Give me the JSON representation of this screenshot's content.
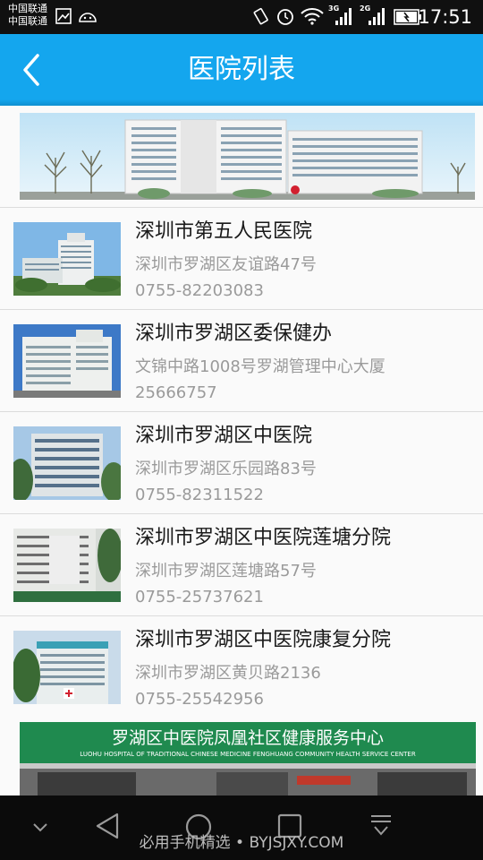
{
  "status_bar": {
    "carrier1": "中国联通",
    "carrier2": "中国联通",
    "net1": "3G",
    "net2": "2G",
    "time": "17:51"
  },
  "header": {
    "title": "医院列表",
    "back_icon": "chevron-left-icon"
  },
  "hospitals": [
    {
      "name": "深圳市第五人民医院",
      "address": "深圳市罗湖区友谊路47号",
      "phone": "0755-82203083"
    },
    {
      "name": "深圳市罗湖区委保健办",
      "address": "文锦中路1008号罗湖管理中心大厦",
      "phone": "25666757"
    },
    {
      "name": "深圳市罗湖区中医院",
      "address": "深圳市罗湖区乐园路83号",
      "phone": "0755-82311522"
    },
    {
      "name": "深圳市罗湖区中医院莲塘分院",
      "address": "深圳市罗湖区莲塘路57号",
      "phone": "0755-25737621"
    },
    {
      "name": "深圳市罗湖区中医院康复分院",
      "address": "深圳市罗湖区黄贝路2136",
      "phone": "0755-25542956"
    }
  ],
  "bottom_banner": {
    "sign_text": "罗湖区中医院凤凰社区健康服务中心",
    "sign_english": "LUOHU HOSPITAL OF TRADITIONAL CHINESE MEDICINE FENGHUANG COMMUNITY HEALTH SERVICE CENTER"
  },
  "nav": {
    "watermark": "必用手机精选 • BYJSJXY.COM"
  },
  "colors": {
    "accent": "#14a6ee",
    "status_bg": "#101010",
    "nav_bg": "#0b0b0b"
  }
}
